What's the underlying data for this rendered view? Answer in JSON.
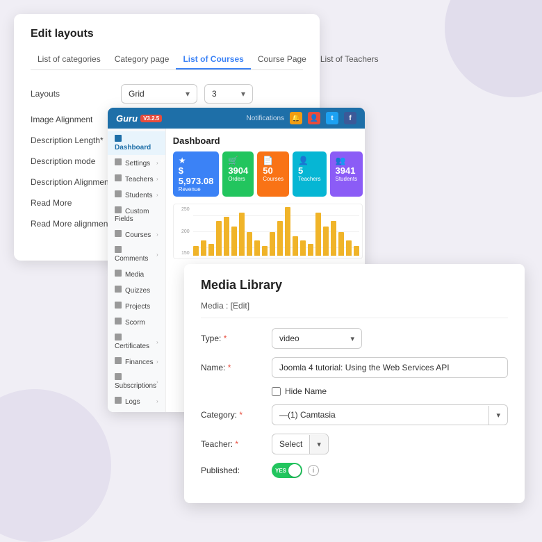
{
  "background": "#f0eef5",
  "editLayouts": {
    "title": "Edit layouts",
    "tabs": [
      {
        "label": "List of categories",
        "active": false
      },
      {
        "label": "Category page",
        "active": false
      },
      {
        "label": "List of Courses",
        "active": true
      },
      {
        "label": "Course Page",
        "active": false
      },
      {
        "label": "List of Teachers",
        "active": false
      }
    ],
    "rows": [
      {
        "label": "Layouts",
        "type": "select-pair"
      },
      {
        "label": "Image Alignment",
        "type": "select"
      },
      {
        "label": "Description Length*",
        "type": "select"
      },
      {
        "label": "Description mode",
        "type": "select"
      },
      {
        "label": "Description Alignment",
        "type": "select"
      },
      {
        "label": "Read More",
        "type": "select"
      },
      {
        "label": "Read More alignment",
        "type": "select"
      }
    ],
    "layoutSelect": "Grid",
    "numSelect": "3"
  },
  "dashboard": {
    "logoText": "Guru",
    "badgeText": "V3.2.5",
    "topbarNotif": "Notifications",
    "activeMenu": "Dashboard",
    "menuItems": [
      {
        "label": "Dashboard",
        "active": true,
        "hasArrow": false
      },
      {
        "label": "Settings",
        "active": false,
        "hasArrow": true
      },
      {
        "label": "Teachers",
        "active": false,
        "hasArrow": true
      },
      {
        "label": "Students",
        "active": false,
        "hasArrow": true
      },
      {
        "label": "Custom Fields",
        "active": false,
        "hasArrow": false
      },
      {
        "label": "Courses",
        "active": false,
        "hasArrow": true
      },
      {
        "label": "Comments",
        "active": false,
        "hasArrow": true
      },
      {
        "label": "Media",
        "active": false,
        "hasArrow": false
      },
      {
        "label": "Quizzes",
        "active": false,
        "hasArrow": false
      },
      {
        "label": "Projects",
        "active": false,
        "hasArrow": false
      },
      {
        "label": "Scorm",
        "active": false,
        "hasArrow": false
      },
      {
        "label": "Certificates",
        "active": false,
        "hasArrow": true
      },
      {
        "label": "Finances",
        "active": false,
        "hasArrow": true
      },
      {
        "label": "Subscriptions",
        "active": false,
        "hasArrow": true
      },
      {
        "label": "Logs",
        "active": false,
        "hasArrow": true
      }
    ],
    "mainTitle": "Dashboard",
    "stats": [
      {
        "value": "$ 5,973.08",
        "sub": "Revenue",
        "color": "stat-blue",
        "icon": "★"
      },
      {
        "value": "3904",
        "sub": "Orders",
        "color": "stat-green",
        "icon": "🛒"
      },
      {
        "value": "50",
        "sub": "Courses",
        "color": "stat-orange",
        "icon": "📄"
      },
      {
        "value": "5",
        "sub": "Teachers",
        "color": "stat-teal",
        "icon": "👤"
      },
      {
        "value": "3941",
        "sub": "Students",
        "color": "stat-purple",
        "icon": "👥"
      }
    ],
    "chartYLabels": [
      "250",
      "200",
      "150"
    ],
    "chartBars": [
      5,
      8,
      6,
      18,
      20,
      15,
      22,
      12,
      8,
      5,
      12,
      18,
      25,
      10,
      8,
      6,
      22,
      15,
      18,
      12,
      8,
      5
    ]
  },
  "mediaLibrary": {
    "title": "Media Library",
    "subtitle": "Media : [Edit]",
    "fields": [
      {
        "label": "Type:",
        "req": true,
        "value": "video",
        "type": "select"
      },
      {
        "label": "Name:",
        "req": true,
        "value": "Joomla 4 tutorial: Using the Web Services API",
        "type": "text"
      },
      {
        "label": "Category:",
        "req": true,
        "value": "—(1) Camtasia",
        "type": "category-select"
      },
      {
        "label": "Teacher:",
        "req": true,
        "value": "Select",
        "type": "teacher-select"
      },
      {
        "label": "Published:",
        "req": false,
        "value": "YES",
        "type": "toggle"
      }
    ],
    "hideNameCheckbox": "Hide Name"
  }
}
